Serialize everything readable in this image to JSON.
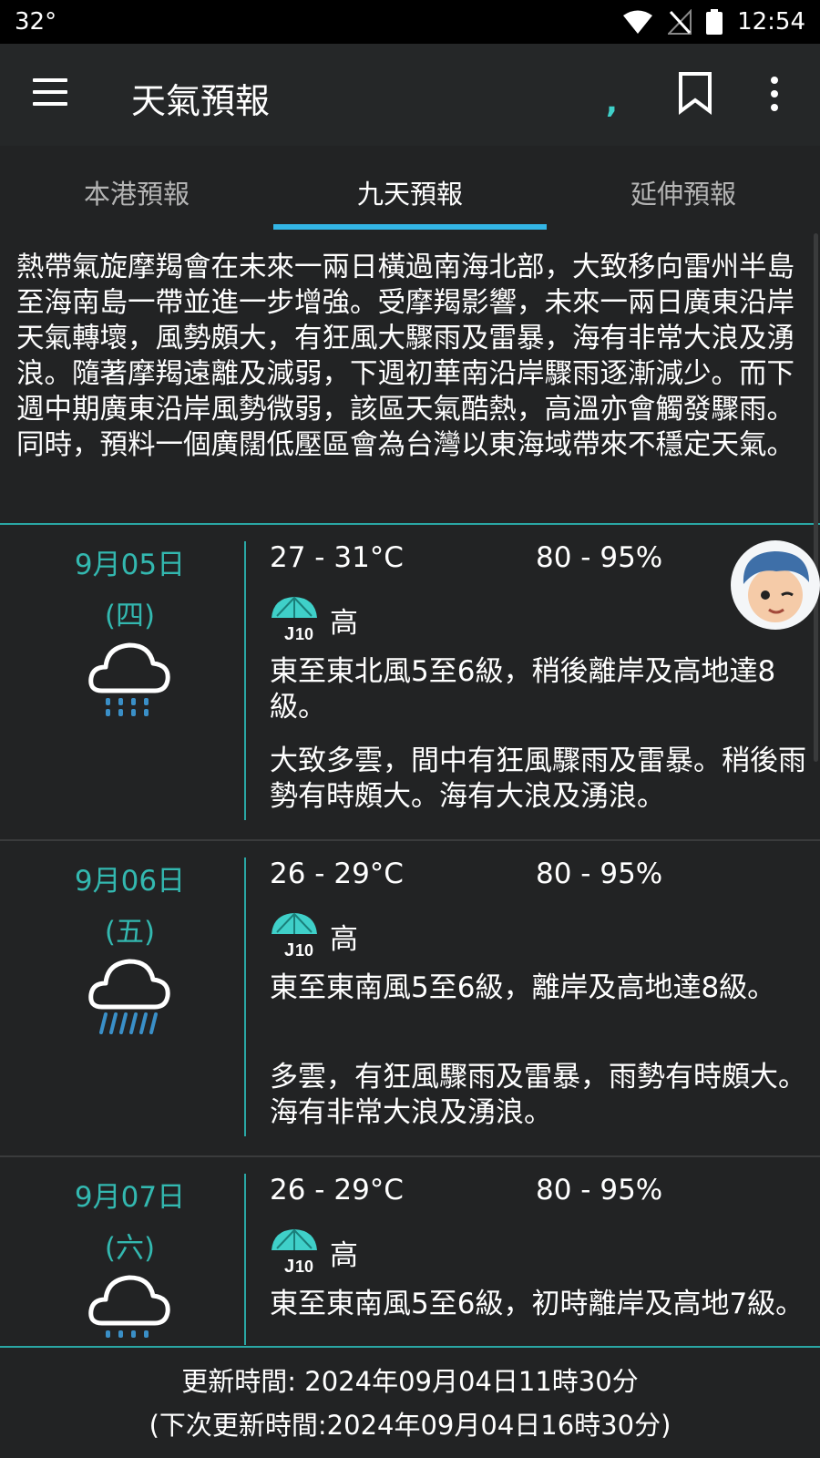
{
  "status_bar": {
    "temperature": "32°",
    "time": "12:54"
  },
  "app_bar": {
    "title": "天氣預報"
  },
  "tabs": [
    {
      "label": "本港預報",
      "active": false
    },
    {
      "label": "九天預報",
      "active": true
    },
    {
      "label": "延伸預報",
      "active": false
    }
  ],
  "summary": "熱帶氣旋摩羯會在未來一兩日橫過南海北部，大致移向雷州半島至海南島一帶並進一步增強。受摩羯影響，未來一兩日廣東沿岸天氣轉壞，風勢頗大，有狂風大驟雨及雷暴，海有非常大浪及湧浪。隨著摩羯遠離及減弱，下週初華南沿岸驟雨逐漸減少。而下週中期廣東沿岸風勢微弱，該區天氣酷熱，高溫亦會觸發驟雨。同時，預料一個廣闊低壓區會為台灣以東海域帶來不穩定天氣。",
  "forecast": [
    {
      "date": "9月05日",
      "weekday": "(四)",
      "temp": "27 - 31°C",
      "rh": "80 - 95%",
      "psr": "高",
      "wind": "東至東北風5至6級，稍後離岸及高地達8級。",
      "desc": "大致多雲，間中有狂風驟雨及雷暴。稍後雨勢有時頗大。海有大浪及湧浪。",
      "icon": "rain-cloud-icon"
    },
    {
      "date": "9月06日",
      "weekday": "(五)",
      "temp": "26 - 29°C",
      "rh": "80 - 95%",
      "psr": "高",
      "wind": "東至東南風5至6級，離岸及高地達8級。",
      "desc": "多雲，有狂風驟雨及雷暴，雨勢有時頗大。海有非常大浪及湧浪。",
      "icon": "heavy-rain-cloud-icon"
    },
    {
      "date": "9月07日",
      "weekday": "(六)",
      "temp": "26 - 29°C",
      "rh": "80 - 95%",
      "psr": "高",
      "wind": "東至東南風5至6級，初時離岸及高地7級。",
      "desc": "",
      "icon": "rain-cloud-icon"
    }
  ],
  "footer": {
    "updated": "更新時間: 2024年09月04日11時30分",
    "next_update": "(下次更新時間:2024年09月04日16時30分)"
  },
  "colors": {
    "accent": "#33b8b0",
    "tab_indicator": "#33b5e5",
    "background": "#222324"
  },
  "icons": [
    "menu-icon",
    "bookmark-icon",
    "more-vert-icon",
    "umbrella-psr-icon",
    "rain-cloud-icon",
    "heavy-rain-cloud-icon",
    "wifi-icon",
    "signal-icon",
    "battery-icon"
  ]
}
